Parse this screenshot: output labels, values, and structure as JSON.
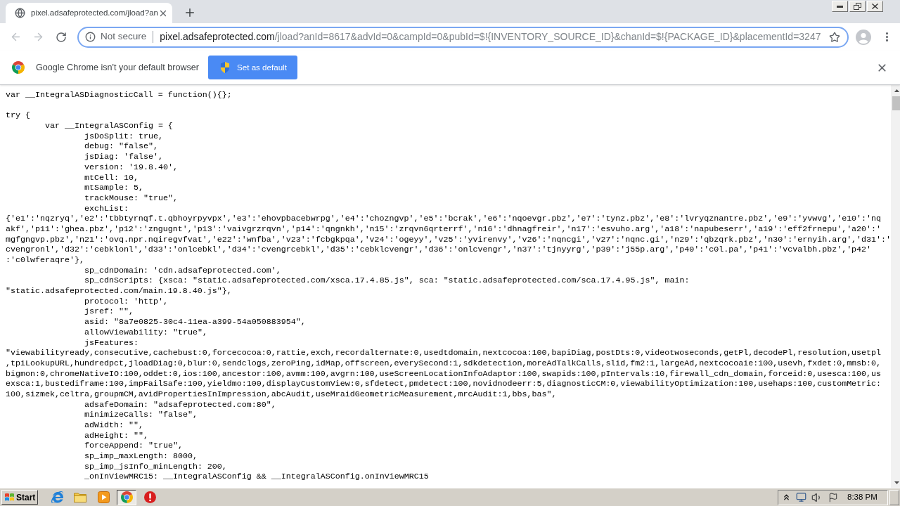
{
  "tab": {
    "title": "pixel.adsafeprotected.com/jload?an"
  },
  "toolbar": {
    "back": {
      "disabled": true
    },
    "forward": {
      "disabled": true
    }
  },
  "omnibox": {
    "security": "Not secure",
    "host": "pixel.adsafeprotected.com",
    "path": "/jload?anId=8617&advId=0&campId=0&pubId=$!{INVENTORY_SOURCE_ID}&chanId=$!{PACKAGE_ID}&placementId=3247"
  },
  "infobar": {
    "message": "Google Chrome isn't your default browser",
    "button": "Set as default"
  },
  "source": {
    "blocks": [
      {
        "lines": [
          {
            "text": "var __IntegralASDiagnosticCall = function(){};"
          }
        ]
      },
      {
        "lines": [
          {
            "text": "try {",
            "children": [
              {
                "text": "var __IntegralASConfig = {",
                "children": [
                  {
                    "text": "jsDoSplit: true,"
                  },
                  {
                    "text": "debug: \"false\","
                  },
                  {
                    "text": "jsDiag: 'false',"
                  },
                  {
                    "text": "version: '19.8.40',"
                  },
                  {
                    "text": "mtCell: 10,"
                  },
                  {
                    "text": "mtSample: 5,"
                  },
                  {
                    "text": "trackMouse: \"true\","
                  },
                  {
                    "text": "exchList:",
                    "wrapped": [
                      "{'e1':'nqzryq','e2':'tbbtyrnqf.t.qbhoyrpyvpx','e3':'ehovpbacebwrpg','e4':'chozngvp','e5':'bcrak','e6':'nqoevgr.pbz','e7':'tynz.pbz','e8':'lvryqznantre.pbz','e9':'yvwvg','e10':'nq",
                      "akf','p11':'ghea.pbz','p12':'zngugnt','p13':'vaivgrzrqvn','p14':'qngnkh','n15':'zrqvn6qrterrf','n16':'dhnagfreir','n17':'esvuho.arg','a18':'napubeserr','a19':'eff2frnepu','a20':'",
                      "mgfgngvp.pbz','n21':'ovq.npr.nqiregvfvat','e22':'wnfba','v23':'fcbgkpqa','v24':'ogeyy','v25':'yvirenvy','v26':'nqncgi','v27':'nqnc.gi','n29':'qbzqrk.pbz','n30':'ernyih.arg','d31':'",
                      "cvengronl','d32':'cebklonl','d33':'onlcebkl','d34':'cvengrcebkl','d35':'cebklcvengr','d36':'onlcvengr','n37':'tjnyyrg','p39':'j55p.arg','p40':'c0l.pa','p41':'vcvalbh.pbz','p42'",
                      ":'c0lwferaqre'},"
                    ]
                  },
                  {
                    "text": "sp_cdnDomain: 'cdn.adsafeprotected.com',"
                  },
                  {
                    "text": "sp_cdnScripts: {xsca: \"static.adsafeprotected.com/xsca.17.4.85.js\", sca: \"static.adsafeprotected.com/sca.17.4.95.js\", main:",
                    "wrapped": [
                      "\"static.adsafeprotected.com/main.19.8.40.js\"},"
                    ]
                  },
                  {
                    "text": "protocol: 'http',"
                  },
                  {
                    "text": "jsref: \"\","
                  },
                  {
                    "text": "asid: \"8a7e0825-30c4-11ea-a399-54a050883954\","
                  },
                  {
                    "text": "allowViewability: \"true\","
                  },
                  {
                    "text": "jsFeatures:",
                    "wrapped": [
                      "\"viewabilityready,consecutive,cachebust:0,forcecocoa:0,rattie,exch,recordalternate:0,usedtdomain,nextcocoa:100,bapiDiag,postDts:0,videotwoseconds,getPl,decodePl,resolution,usetpl",
                      ",tpiLookupURL,hundredpct,jloadDiag:0,blur:0,sendclogs,zeroPing,idMap,offscreen,everySecond:1,sdkdetection,moreAdTalkCalls,slid,fm2:1,largeAd,nextcocoaie:100,usevh,fxdet:0,mmsb:0,",
                      "bigmon:0,chromeNativeIO:100,oddet:0,ios:100,ancestor:100,avmm:100,avgrn:100,useScreenLocationInfoAdaptor:100,swapids:100,pIntervals:10,firewall_cdn_domain,forceid:0,usesca:100,us",
                      "exsca:1,bustediframe:100,impFailSafe:100,yieldmo:100,displayCustomView:0,sfdetect,pmdetect:100,novidnodeerr:5,diagnosticCM:0,viewabilityOptimization:100,usehaps:100,customMetric:",
                      "100,sizmek,celtra,groupmCM,avidPropertiesInImpression,abcAudit,useMraidGeometricMeasurement,mrcAudit:1,bbs,bas\","
                    ]
                  },
                  {
                    "text": "adsafeDomain: \"adsafeprotected.com:80\","
                  },
                  {
                    "text": "minimizeCalls: \"false\","
                  },
                  {
                    "text": "adWidth: \"\","
                  },
                  {
                    "text": "adHeight: \"\","
                  },
                  {
                    "text": "forceAppend: \"true\","
                  },
                  {
                    "text": "sp_imp_maxLength: 8000,"
                  },
                  {
                    "text": "sp_imp_jsInfo_minLength: 200,"
                  },
                  {
                    "text": "_onInViewMRC15: __IntegralASConfig && __IntegralASConfig.onInViewMRC15"
                  }
                ]
              }
            ]
          }
        ]
      }
    ]
  },
  "taskbar": {
    "start": "Start",
    "apps": [
      {
        "kind": "e-logo",
        "selected": false
      },
      {
        "kind": "folder",
        "selected": false
      },
      {
        "kind": "play",
        "selected": false
      },
      {
        "kind": "browser",
        "selected": true
      },
      {
        "kind": "alert",
        "selected": false
      }
    ],
    "clock": "8:38 PM"
  }
}
